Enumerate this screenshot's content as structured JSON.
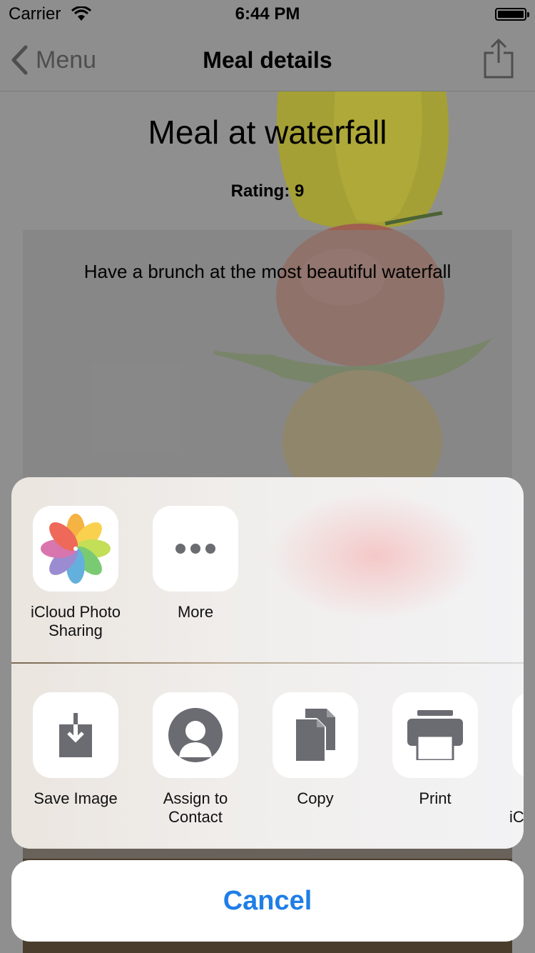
{
  "status_bar": {
    "carrier": "Carrier",
    "time": "6:44 PM"
  },
  "navbar": {
    "back_label": "Menu",
    "title": "Meal details",
    "share_icon": "share-icon"
  },
  "meal": {
    "title": "Meal at waterfall",
    "rating": "Rating: 9",
    "description": "Have a brunch at the most beautiful waterfall"
  },
  "share_sheet": {
    "app_row": [
      {
        "label": "iCloud Photo Sharing",
        "icon": "photos-icon"
      },
      {
        "label": "More",
        "icon": "more-icon"
      }
    ],
    "action_row": [
      {
        "label": "Save Image",
        "icon": "save-image-icon"
      },
      {
        "label": "Assign to Contact",
        "icon": "contact-icon"
      },
      {
        "label": "Copy",
        "icon": "copy-icon"
      },
      {
        "label": "Print",
        "icon": "print-icon"
      },
      {
        "label": "iC",
        "icon": "partial-icon"
      }
    ],
    "cancel_label": "Cancel"
  },
  "colors": {
    "accent": "#1f7ee6",
    "dimmed_background": "#8e8e8e",
    "icon_gray": "#6b6b72"
  }
}
